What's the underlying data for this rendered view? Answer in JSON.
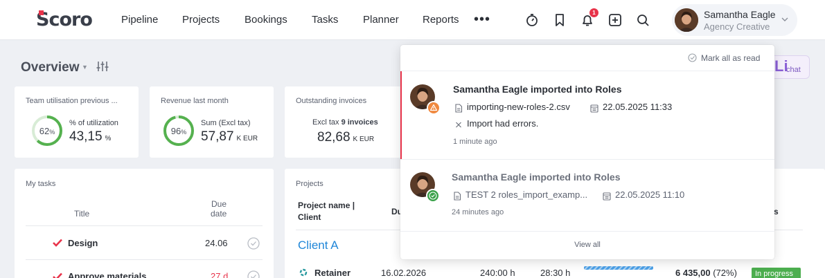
{
  "app": {
    "logo_text": "Scoro"
  },
  "nav": {
    "items": [
      "Pipeline",
      "Projects",
      "Bookings",
      "Tasks",
      "Planner",
      "Reports"
    ],
    "more": "•••"
  },
  "header": {
    "notification_count": "1",
    "user_name": "Samantha Eagle",
    "user_role": "Agency Creative"
  },
  "overview": {
    "title": "Overview"
  },
  "cards": {
    "utilisation": {
      "title": "Team utilisation previous ...",
      "percent": "62",
      "percent_sign": "%",
      "label": "% of utilization",
      "value": "43,15",
      "unit": "%",
      "ring_fraction": 0.62,
      "ring_color": "#55b14f"
    },
    "revenue": {
      "title": "Revenue last month",
      "percent": "96",
      "percent_sign": "%",
      "label": "Sum (Excl tax)",
      "value": "57,87",
      "unit": "K  EUR",
      "ring_fraction": 0.96,
      "ring_color": "#55b14f"
    },
    "invoices": {
      "title": "Outstanding invoices",
      "label_prefix": "Excl tax",
      "label_bold": "9 invoices",
      "value": "82,68",
      "unit": "K  EUR"
    }
  },
  "my_tasks": {
    "title": "My tasks",
    "col_title": "Title",
    "col_due_1": "Due",
    "col_due_2": "date",
    "rows": [
      {
        "title": "Design",
        "due": "24.06"
      },
      {
        "title": "Approve materials",
        "due": "27 d"
      }
    ]
  },
  "projects": {
    "title": "Projects",
    "col_name_1": "Project name |",
    "col_name_2": "Client",
    "col_du": "Du",
    "col_s": "s",
    "client": "Client A",
    "row": {
      "name": "Retainer",
      "date": "16.02.2026",
      "hours": "240:00 h",
      "spent": "28:30 h",
      "progress": 1.0,
      "amount": "6 435,00",
      "percent": "(72%)",
      "status": "In progress"
    }
  },
  "chat": {
    "label": "chat"
  },
  "notifications": {
    "mark_all": "Mark all as read",
    "view_all": "View all",
    "items": [
      {
        "title": "Samantha Eagle imported into Roles",
        "file": "importing-new-roles-2.csv",
        "date": "22.05.2025 11:33",
        "message": "Import had errors.",
        "time": "1 minute ago",
        "status": "warning",
        "status_color": "#f0883e"
      },
      {
        "title": "Samantha Eagle imported into Roles",
        "file": "TEST 2 roles_import_examp...",
        "date": "22.05.2025 11:10",
        "time": "24 minutes ago",
        "status": "success",
        "status_color": "#3aa14a"
      }
    ]
  }
}
